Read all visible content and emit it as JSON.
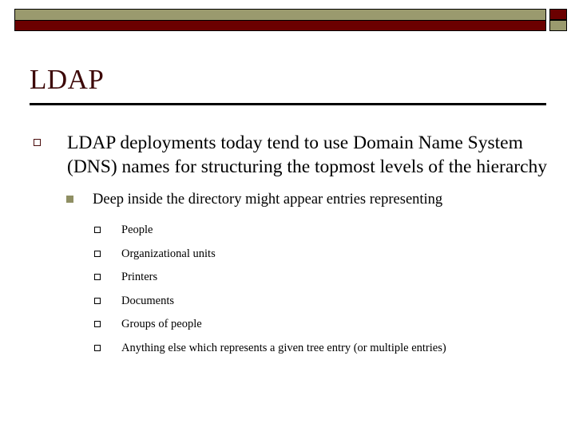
{
  "slide": {
    "title": "LDAP",
    "theme": {
      "banner_khaki": "#9a9a6e",
      "banner_maroon": "#6b0000",
      "title_color": "#3d0808",
      "rule_color": "#000000",
      "lvl1_marker_color": "#4a0d0d",
      "lvl2_marker_color": "#8f8f63",
      "lvl3_marker_color": "#000000"
    },
    "banner": {
      "top_bar_name": "khaki-bar",
      "bottom_bar_name": "maroon-bar",
      "corner_top_block": "maroon-block",
      "corner_bottom_block": "khaki-block"
    },
    "bullets": {
      "level1": {
        "marker": "hollow-square-marker",
        "text": "LDAP deployments today tend to use Domain Name System (DNS) names for structuring the topmost levels of the hierarchy"
      },
      "level2": {
        "marker": "filled-square-marker",
        "text": "Deep inside the directory might appear entries representing"
      },
      "level3": {
        "marker": "hollow-square-marker",
        "items": [
          "People",
          "Organizational units",
          "Printers",
          "Documents",
          "Groups of people",
          "Anything else which represents a given tree entry (or multiple entries)"
        ]
      }
    }
  }
}
